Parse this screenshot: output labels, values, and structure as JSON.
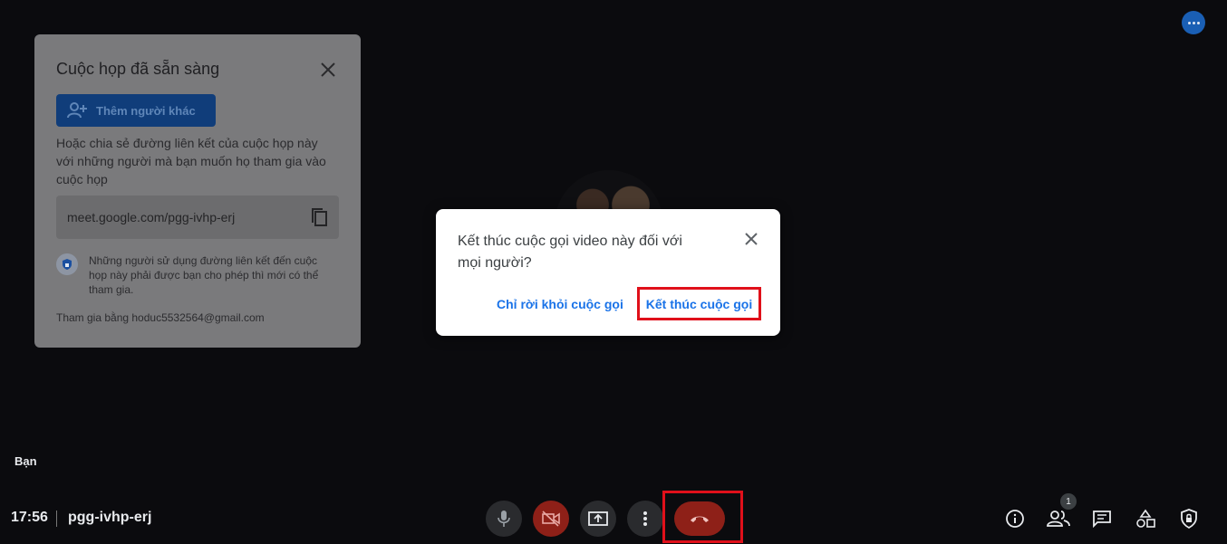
{
  "info_panel": {
    "title": "Cuộc họp đã sẵn sàng",
    "add_button": "Thêm người khác",
    "description": "Hoặc chia sẻ đường liên kết của cuộc họp này với những người mà bạn muốn họ tham gia vào cuộc họp",
    "meeting_link": "meet.google.com/pgg-ivhp-erj",
    "security_note": "Những người sử dụng đường liên kết đến cuộc họp này phải được bạn cho phép thì mới có thể tham gia.",
    "joined_as": "Tham gia bằng hoduc5532564@gmail.com"
  },
  "tile": {
    "you_label": "Bạn"
  },
  "dialog": {
    "message": "Kết thúc cuộc gọi video này đối với mọi người?",
    "leave_button": "Chỉ rời khỏi cuộc gọi",
    "end_button": "Kết thúc cuộc gọi"
  },
  "bottom_bar": {
    "time": "17:56",
    "meeting_code": "pgg-ivhp-erj",
    "participants_count": "1"
  },
  "colors": {
    "background": "#0b0b0e",
    "accent_blue": "#1a73e8",
    "hangup_red": "#8e2018",
    "highlight_red": "#e0101a"
  }
}
